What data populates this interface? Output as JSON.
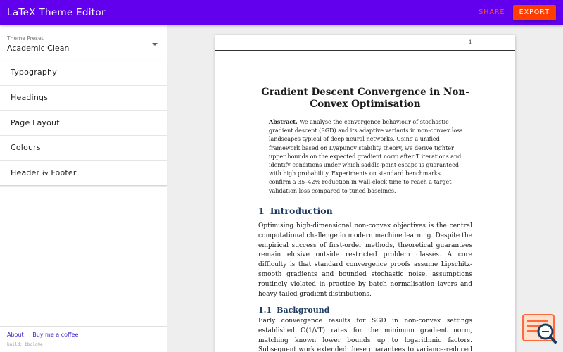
{
  "app": {
    "title": "LaTeX Theme Editor"
  },
  "toolbar": {
    "share_label": "SHARE",
    "export_label": "EXPORT"
  },
  "sidebar": {
    "preset_label": "Theme Preset",
    "preset_value": "Academic Clean",
    "sections": [
      "Typography",
      "Headings",
      "Page Layout",
      "Colours",
      "Header & Footer"
    ],
    "footer": {
      "about": "About",
      "coffee": "Buy me a coffee",
      "build": "build: bbc1d0e"
    }
  },
  "document": {
    "page_number": "1",
    "title": "Gradient Descent Convergence in Non-Convex Optimisation",
    "abstract_label": "Abstract.",
    "abstract_text": "We analyse the convergence behaviour of stochastic gradient descent (SGD) and its adaptive variants in non-convex loss landscapes typical of deep neural networks. Using a unified framework based on Lyapunov stability theory, we derive tighter upper bounds on the expected gradient norm after T iterations and identify conditions under which saddle-point escape is guaranteed with high probability. Experiments on standard benchmarks confirm a 35–42% reduction in wall-clock time to reach a target validation loss compared to tuned baselines.",
    "section1": {
      "number": "1",
      "title": "Introduction",
      "text": "Optimising high-dimensional non-convex objectives is the central computational challenge in modern machine learning. Despite the empirical success of first-order methods, theoretical guarantees remain elusive outside restricted problem classes. A core difficulty is that standard convergence proofs assume Lipschitz-smooth gradients and bounded stochastic noise, assumptions routinely violated in practice by batch normalisation layers and heavy-tailed gradient distributions."
    },
    "section1_1": {
      "number": "1.1",
      "title": "Background",
      "text": "Early convergence results for SGD in non-convex settings established O(1/√T) rates for the minimum gradient norm, matching known lower bounds up to logarithmic factors. Subsequent work extended these guarantees to variance-reduced methods."
    }
  },
  "colors": {
    "appbar": "#6200ee",
    "share": "#ff5722",
    "export": "#ff3d00",
    "heading": "#1e3a5f",
    "link": "#3f1dcb"
  },
  "widget": {
    "icon": "document-search-icon"
  }
}
